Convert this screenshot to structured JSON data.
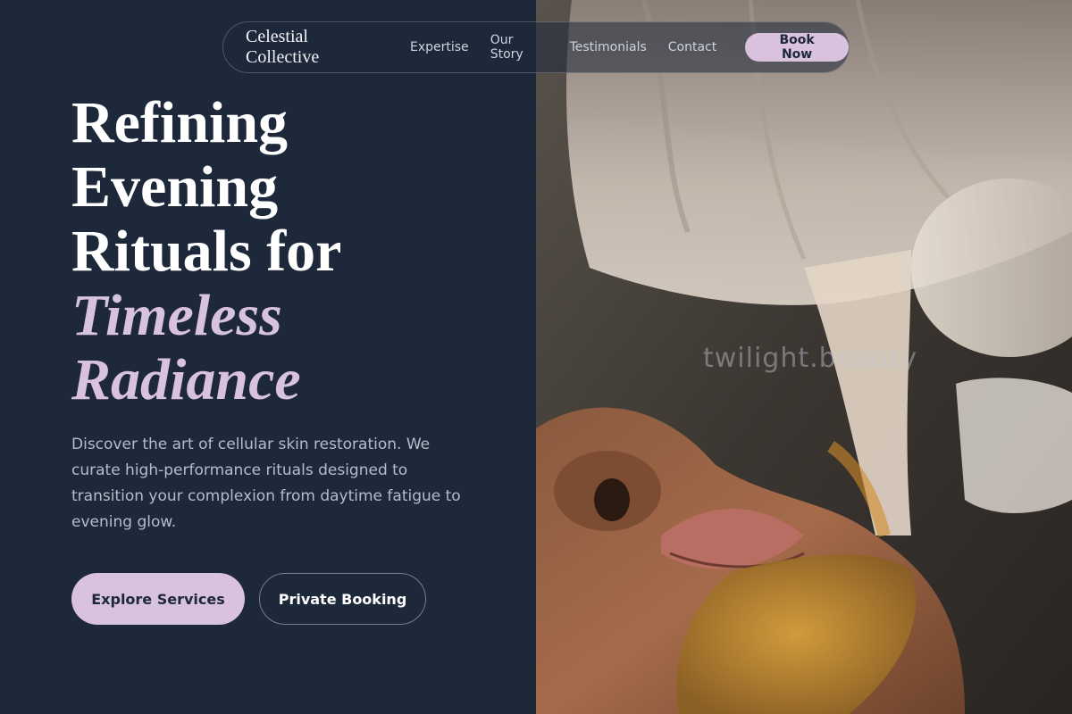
{
  "nav": {
    "brand": "Celestial Collective",
    "links": [
      "Expertise",
      "Our Story",
      "Testimonials",
      "Contact"
    ],
    "cta": "Book Now"
  },
  "hero": {
    "headline_lines": [
      "Refining",
      "Evening",
      "Rituals for"
    ],
    "headline_accent_lines": [
      "Timeless",
      "Radiance"
    ],
    "description": "Discover the art of cellular skin restoration. We curate high-performance rituals designed to transition your complexion from daytime fatigue to evening glow.",
    "primary_button": "Explore Services",
    "secondary_button": "Private Booking"
  },
  "image": {
    "watermark": "twilight.beauty"
  },
  "colors": {
    "background": "#1e283b",
    "accent": "#d9c2dd",
    "text_primary": "#ffffff",
    "text_muted": "#b6bcc8"
  }
}
